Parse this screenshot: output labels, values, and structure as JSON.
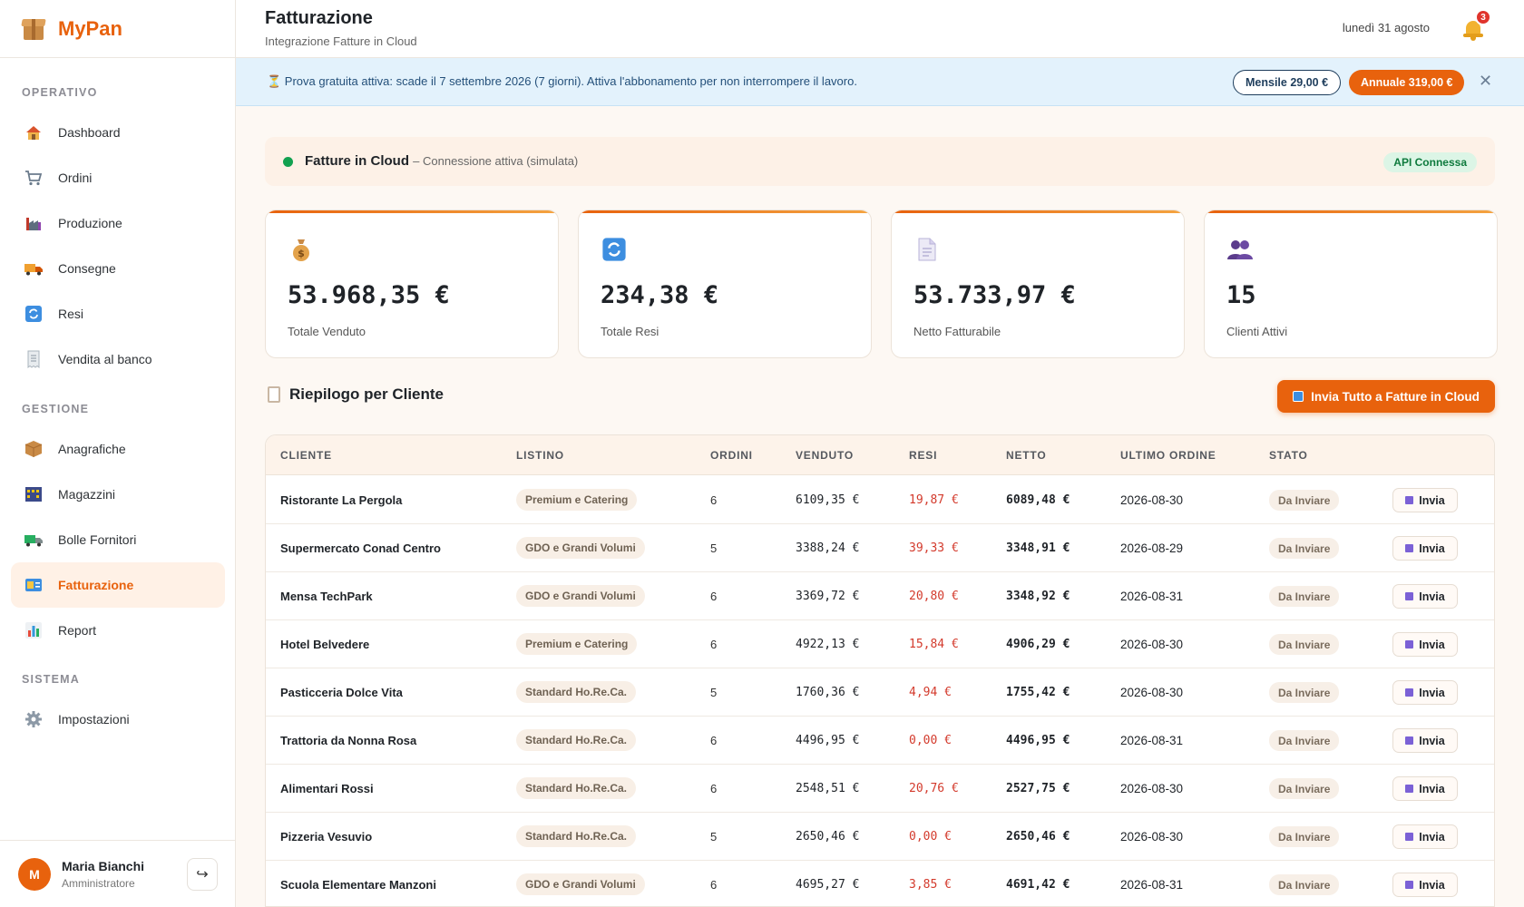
{
  "brand": {
    "name": "MyPan"
  },
  "sidebar": {
    "sections": [
      "OPERATIVO",
      "GESTIONE",
      "SISTEMA"
    ],
    "items": [
      {
        "label": "Dashboard",
        "icon": "house-icon"
      },
      {
        "label": "Ordini",
        "icon": "cart-icon"
      },
      {
        "label": "Produzione",
        "icon": "factory-icon"
      },
      {
        "label": "Consegne",
        "icon": "truck-icon"
      },
      {
        "label": "Resi",
        "icon": "refresh-icon"
      },
      {
        "label": "Vendita al banco",
        "icon": "receipt-icon"
      },
      {
        "label": "Anagrafiche",
        "icon": "package-icon"
      },
      {
        "label": "Magazzini",
        "icon": "warehouse-icon"
      },
      {
        "label": "Bolle Fornitori",
        "icon": "delivery-truck-icon"
      },
      {
        "label": "Fatturazione",
        "icon": "billing-icon",
        "active": true
      },
      {
        "label": "Report",
        "icon": "bar-chart-icon"
      },
      {
        "label": "Impostazioni",
        "icon": "gear-icon"
      }
    ]
  },
  "user": {
    "initial": "M",
    "name": "Maria Bianchi",
    "role": "Amministratore"
  },
  "header": {
    "title": "Fatturazione",
    "subtitle": "Integrazione Fatture in Cloud",
    "date": "lunedì 31 agosto",
    "notifications": "3"
  },
  "banner": {
    "text": "⏳ Prova gratuita attiva: scade il 7 settembre 2026 (7 giorni). Attiva l'abbonamento per non interrompere il lavoro.",
    "monthly": "Mensile 29,00 €",
    "annual": "Annuale 319,00 €"
  },
  "connection": {
    "name": "Fatture in Cloud",
    "status": "– Connessione attiva (simulata)",
    "badge": "API Connessa",
    "status_color": "#12a150"
  },
  "stats": [
    {
      "value": "53.968,35 €",
      "label": "Totale Venduto",
      "icon": "money-bag-icon"
    },
    {
      "value": "234,38 €",
      "label": "Totale Resi",
      "icon": "refresh-icon"
    },
    {
      "value": "53.733,97 €",
      "label": "Netto Fatturabile",
      "icon": "document-icon"
    },
    {
      "value": "15",
      "label": "Clienti Attivi",
      "icon": "users-icon"
    }
  ],
  "summary": {
    "title": "Riepilogo per Cliente",
    "send_all": "Invia Tutto a Fatture in Cloud"
  },
  "table": {
    "columns": [
      "CLIENTE",
      "LISTINO",
      "ORDINI",
      "VENDUTO",
      "RESI",
      "NETTO",
      "ULTIMO ORDINE",
      "STATO"
    ],
    "action_label": "Invia",
    "rows": [
      {
        "client": "Ristorante La Pergola",
        "list": "Premium e Catering",
        "orders": "6",
        "sold": "6109,35 €",
        "returns": "19,87 €",
        "net": "6089,48 €",
        "last": "2026-08-30",
        "status": "Da Inviare"
      },
      {
        "client": "Supermercato Conad Centro",
        "list": "GDO e Grandi Volumi",
        "orders": "5",
        "sold": "3388,24 €",
        "returns": "39,33 €",
        "net": "3348,91 €",
        "last": "2026-08-29",
        "status": "Da Inviare"
      },
      {
        "client": "Mensa TechPark",
        "list": "GDO e Grandi Volumi",
        "orders": "6",
        "sold": "3369,72 €",
        "returns": "20,80 €",
        "net": "3348,92 €",
        "last": "2026-08-31",
        "status": "Da Inviare"
      },
      {
        "client": "Hotel Belvedere",
        "list": "Premium e Catering",
        "orders": "6",
        "sold": "4922,13 €",
        "returns": "15,84 €",
        "net": "4906,29 €",
        "last": "2026-08-30",
        "status": "Da Inviare"
      },
      {
        "client": "Pasticceria Dolce Vita",
        "list": "Standard Ho.Re.Ca.",
        "orders": "5",
        "sold": "1760,36 €",
        "returns": "4,94 €",
        "net": "1755,42 €",
        "last": "2026-08-30",
        "status": "Da Inviare"
      },
      {
        "client": "Trattoria da Nonna Rosa",
        "list": "Standard Ho.Re.Ca.",
        "orders": "6",
        "sold": "4496,95 €",
        "returns": "0,00 €",
        "net": "4496,95 €",
        "last": "2026-08-31",
        "status": "Da Inviare"
      },
      {
        "client": "Alimentari Rossi",
        "list": "Standard Ho.Re.Ca.",
        "orders": "6",
        "sold": "2548,51 €",
        "returns": "20,76 €",
        "net": "2527,75 €",
        "last": "2026-08-30",
        "status": "Da Inviare"
      },
      {
        "client": "Pizzeria Vesuvio",
        "list": "Standard Ho.Re.Ca.",
        "orders": "5",
        "sold": "2650,46 €",
        "returns": "0,00 €",
        "net": "2650,46 €",
        "last": "2026-08-30",
        "status": "Da Inviare"
      },
      {
        "client": "Scuola Elementare Manzoni",
        "list": "GDO e Grandi Volumi",
        "orders": "6",
        "sold": "4695,27 €",
        "returns": "3,85 €",
        "net": "4691,42 €",
        "last": "2026-08-31",
        "status": "Da Inviare"
      }
    ]
  }
}
